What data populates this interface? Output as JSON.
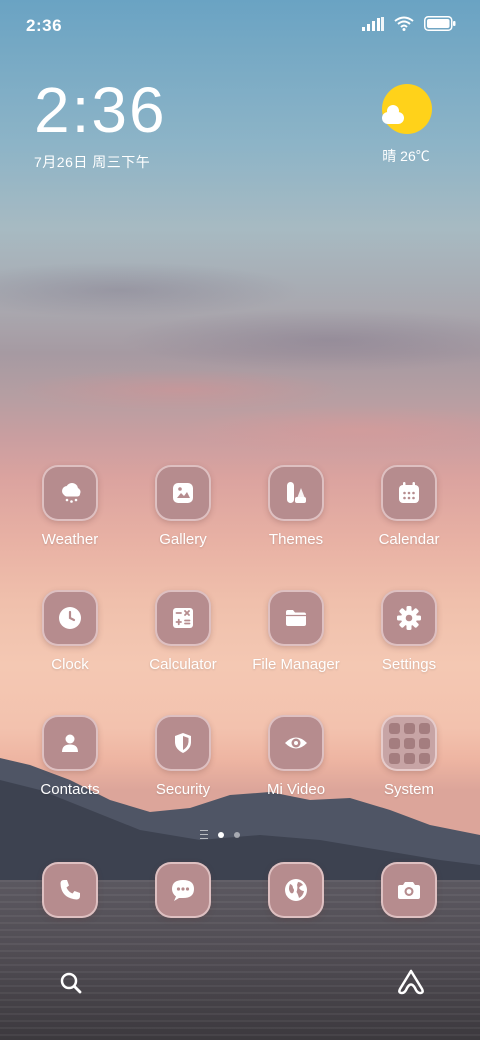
{
  "status_bar": {
    "time": "2:36"
  },
  "clock_widget": {
    "time": "2:36",
    "date": "7月26日 周三下午"
  },
  "weather_widget": {
    "condition": "晴",
    "temperature": "26℃",
    "icon": "sunny-partly-cloudy-icon"
  },
  "apps": [
    {
      "label": "Weather",
      "icon": "weather-icon"
    },
    {
      "label": "Gallery",
      "icon": "gallery-icon"
    },
    {
      "label": "Themes",
      "icon": "themes-icon"
    },
    {
      "label": "Calendar",
      "icon": "calendar-icon"
    },
    {
      "label": "Clock",
      "icon": "clock-icon"
    },
    {
      "label": "Calculator",
      "icon": "calculator-icon"
    },
    {
      "label": "File Manager",
      "icon": "folder-icon"
    },
    {
      "label": "Settings",
      "icon": "gear-icon"
    },
    {
      "label": "Contacts",
      "icon": "person-icon"
    },
    {
      "label": "Security",
      "icon": "shield-icon"
    },
    {
      "label": "Mi Video",
      "icon": "eye-icon"
    },
    {
      "label": "System",
      "icon": "folder-grid-icon"
    }
  ],
  "dock": [
    {
      "icon": "phone-icon"
    },
    {
      "icon": "message-icon"
    },
    {
      "icon": "browser-icon"
    },
    {
      "icon": "camera-icon"
    }
  ],
  "page_indicator": {
    "pages": 2,
    "current": 1
  },
  "bottom_bar": {
    "left_icon": "search-icon",
    "right_icon": "assistant-icon"
  },
  "colors": {
    "icon_bg": "#b68c8e",
    "sun": "#ffd21a"
  }
}
